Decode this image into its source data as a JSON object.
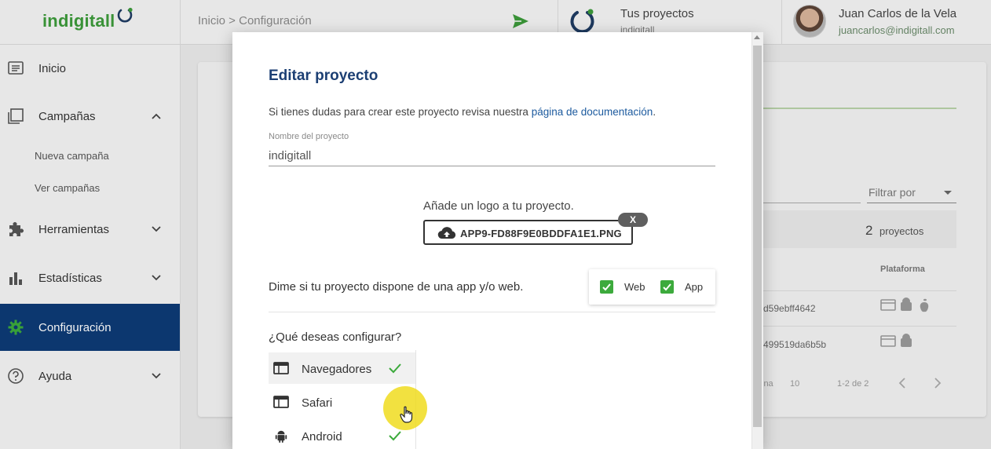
{
  "header": {
    "logo_text": "indigitall",
    "breadcrumb": "Inicio > Configuración",
    "projects_title": "Tus proyectos",
    "projects_subtitle": "indigitall",
    "user_name": "Juan Carlos de la Vela",
    "user_email": "juancarlos@indigitall.com"
  },
  "sidebar": {
    "items": [
      {
        "label": "Inicio",
        "icon": "list-icon"
      },
      {
        "label": "Campañas",
        "icon": "campaigns-icon",
        "expanded": true
      },
      {
        "label": "Herramientas",
        "icon": "puzzle-icon"
      },
      {
        "label": "Estadísticas",
        "icon": "bar-chart-icon"
      },
      {
        "label": "Configuración",
        "icon": "gear-icon",
        "active": true
      },
      {
        "label": "Ayuda",
        "icon": "help-icon"
      }
    ],
    "subitems": [
      "Nueva campaña",
      "Ver campañas"
    ]
  },
  "background": {
    "filter_label": "Filtrar por",
    "project_count": "2",
    "project_count_label": "proyectos",
    "platform_header": "Plataforma",
    "rows": [
      "d59ebff4642",
      "499519da6b5b"
    ],
    "pagination_page": "ina",
    "pagination_size": "10",
    "pagination_range": "1-2 de 2"
  },
  "modal": {
    "title": "Editar proyecto",
    "help_text": "Si tienes dudas para crear este proyecto revisa nuestra ",
    "help_link": "página de documentación",
    "help_end": ".",
    "name_label": "Nombre del proyecto",
    "name_value": "indigitall",
    "logo_label": "Añade un logo a tu proyecto.",
    "logo_file": "APP9-FD88F9E0BDDFA1E1.PNG",
    "remove_label": "X",
    "platform_question": "Dime si tu proyecto dispone de una app y/o web.",
    "web_label": "Web",
    "app_label": "App",
    "web_checked": true,
    "app_checked": true,
    "config_question": "¿Qué deseas configurar?",
    "config_items": [
      {
        "label": "Navegadores",
        "configured": true,
        "selected": true
      },
      {
        "label": "Safari",
        "configured": false
      },
      {
        "label": "Android",
        "configured": true
      }
    ]
  },
  "colors": {
    "brand_green": "#3d9a3a",
    "nav_active": "#0d3a75",
    "title_blue": "#1c3f73",
    "checkbox_green": "#3caa3c"
  }
}
